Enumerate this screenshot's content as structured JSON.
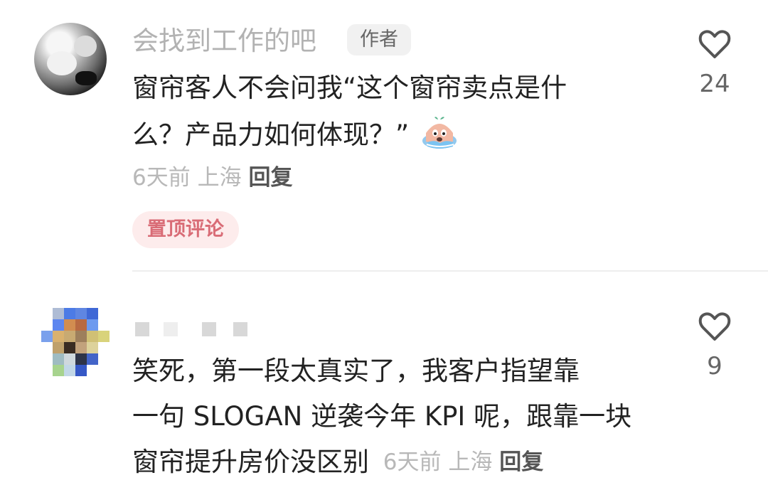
{
  "comments": [
    {
      "username": "会找到工作的吧",
      "author_badge": "作者",
      "text_line1": "窗帘客人不会问我“这个窗帘卖点是什",
      "text_line2": "么？产品力如何体现？”",
      "emoji": "crying-emoji",
      "time": "6天前",
      "location": "上海",
      "reply_label": "回复",
      "pin_label": "置顶评论",
      "likes": "24"
    },
    {
      "username": "",
      "text_line1": "笑死，第一段太真实了，我客户指望靠",
      "text_line2": "一句 SLOGAN 逆袭今年 KPI 呢，跟靠一块",
      "text_line3": "窗帘提升房价没区别",
      "time": "6天前",
      "location": "上海",
      "reply_label": "回复",
      "likes": "9"
    }
  ],
  "colors": {
    "username": "#b2b2b2",
    "text": "#222222",
    "meta": "#b8b8b8",
    "pin_background": "#fdecec",
    "pin_text": "#d96c76",
    "heart": "#555555"
  },
  "avatar_pixels": [
    [
      "#ffffff",
      "#aebcd5",
      "#4c7be6",
      "#5f86e2",
      "#3f68d6",
      "#ffffff"
    ],
    [
      "#ffffff",
      "#5d86ef",
      "#d28d50",
      "#b86a42",
      "#6d9aef",
      "#ffffff"
    ],
    [
      "#7aa0ec",
      "#d9b16e",
      "#c8aa72",
      "#9d7f5c",
      "#d0c075",
      "#d9d37b"
    ],
    [
      "#ffffff",
      "#bfa16c",
      "#3a2c22",
      "#c2a27c",
      "#ddd29b",
      "#ffffff"
    ],
    [
      "#ffffff",
      "#9fbcc2",
      "#cfd8dd",
      "#2e3448",
      "#4364c8",
      "#ffffff"
    ],
    [
      "#ffffff",
      "#a7d38e",
      "#c2d7e7",
      "#3658c6",
      "#ffffff",
      "#ffffff"
    ]
  ]
}
